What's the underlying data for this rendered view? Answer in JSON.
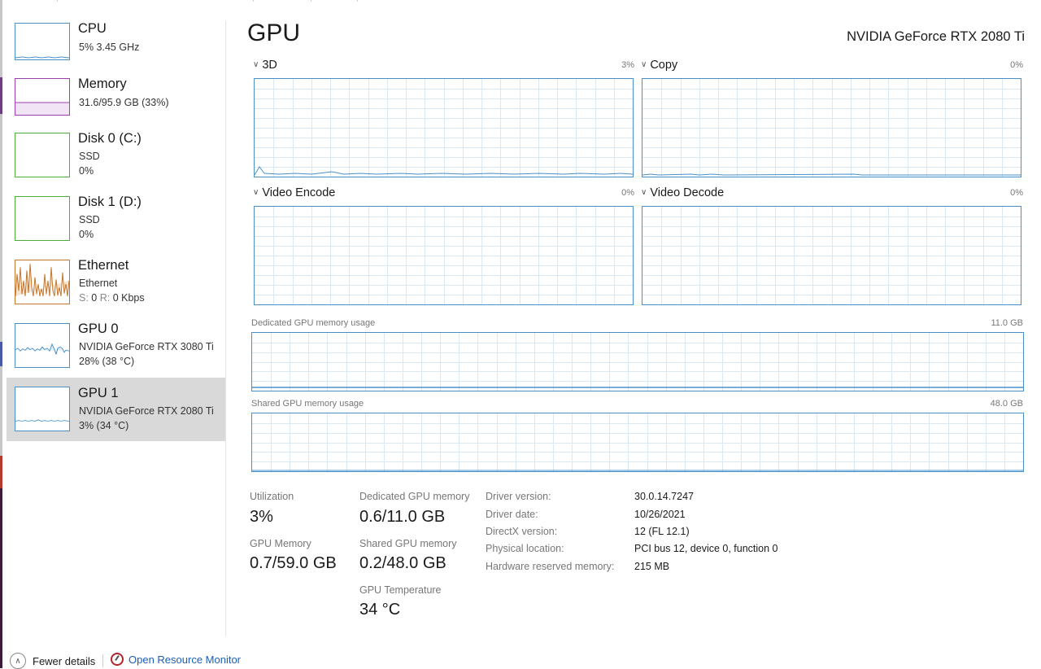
{
  "sidebar": {
    "items": [
      {
        "title": "CPU",
        "line1": "5%  3.45 GHz",
        "line2": ""
      },
      {
        "title": "Memory",
        "line1": "31.6/95.9 GB (33%)",
        "line2": ""
      },
      {
        "title": "Disk 0 (C:)",
        "line1": "SSD",
        "line2": "0%"
      },
      {
        "title": "Disk 1 (D:)",
        "line1": "SSD",
        "line2": "0%"
      },
      {
        "title": "Ethernet",
        "line1": "Ethernet",
        "line2_s": "S:",
        "line2_s_val": "0",
        "line2_r": "R:",
        "line2_r_val": "0 Kbps"
      },
      {
        "title": "GPU 0",
        "line1": "NVIDIA GeForce RTX 3080 Ti",
        "line2": "28%  (38 °C)"
      },
      {
        "title": "GPU 1",
        "line1": "NVIDIA GeForce RTX 2080 Ti",
        "line2": "3%  (34 °C)",
        "selected": true
      }
    ]
  },
  "header": {
    "title": "GPU",
    "device_name": "NVIDIA GeForce RTX 2080 Ti"
  },
  "graphs": {
    "three_d": {
      "label": "3D",
      "percent": "3%"
    },
    "copy": {
      "label": "Copy",
      "percent": "0%"
    },
    "video_encode": {
      "label": "Video Encode",
      "percent": "0%"
    },
    "video_decode": {
      "label": "Video Decode",
      "percent": "0%"
    },
    "dedicated_memory": {
      "label": "Dedicated GPU memory usage",
      "max": "11.0 GB"
    },
    "shared_memory": {
      "label": "Shared GPU memory usage",
      "max": "48.0 GB"
    }
  },
  "stats": {
    "utilization_label": "Utilization",
    "utilization_value": "3%",
    "gpu_memory_label": "GPU Memory",
    "gpu_memory_value": "0.7/59.0 GB",
    "dedicated_label": "Dedicated GPU memory",
    "dedicated_value": "0.6/11.0 GB",
    "shared_label": "Shared GPU memory",
    "shared_value": "0.2/48.0 GB",
    "temp_label": "GPU Temperature",
    "temp_value": "34 °C"
  },
  "info": {
    "driver_version_label": "Driver version:",
    "driver_version_value": "30.0.14.7247",
    "driver_date_label": "Driver date:",
    "driver_date_value": "10/26/2021",
    "directx_label": "DirectX version:",
    "directx_value": "12 (FL 12.1)",
    "physical_label": "Physical location:",
    "physical_value": "PCI bus 12, device 0, function 0",
    "reserved_label": "Hardware reserved memory:",
    "reserved_value": "215 MB"
  },
  "footer": {
    "fewer_details": "Fewer details",
    "open_resource_monitor": "Open Resource Monitor"
  },
  "colors": {
    "graph_border": "#4a90c8",
    "memory_accent": "#9b3fb0",
    "disk_accent": "#4caf3a",
    "ethernet_accent": "#c5762a",
    "selected_bg": "#d9d9d9",
    "link": "#1a5fb4"
  }
}
